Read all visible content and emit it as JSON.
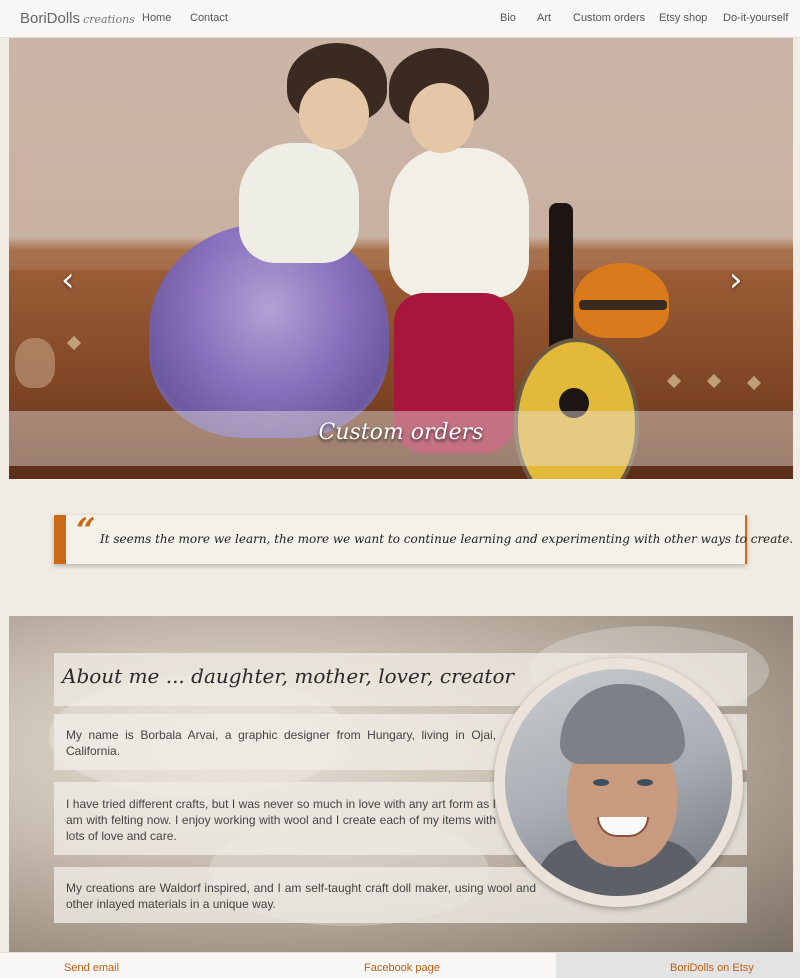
{
  "navbar": {
    "brand": "BoriDolls",
    "brand_sub": "creations",
    "left_links": [
      "Home",
      "Contact"
    ],
    "right_links": [
      "Bio",
      "Art",
      "Custom orders",
      "Etsy shop",
      "Do-it-yourself"
    ]
  },
  "hero": {
    "caption": "Custom orders",
    "prev_icon": "chevron-left-icon",
    "next_icon": "chevron-right-icon"
  },
  "quote": {
    "mark": "“",
    "text": "It seems the more we learn, the more we want to continue learning and experimenting with other ways to create."
  },
  "about": {
    "title": "About me ... daughter, mother, lover, creator",
    "paragraphs": [
      "My name is Borbala Arvai, a graphic designer from Hungary, living in Ojai, California.",
      "I have tried different crafts, but I was never so much in love with any art form as I am with felting now. I enjoy working with wool and I create each of my items with lots of love and care.",
      "My creations are Waldorf inspired, and I am self-taught craft doll maker, using wool and other inlayed materials in a unique way."
    ]
  },
  "footer": {
    "email": "Send email",
    "facebook": "Facebook page",
    "etsy": "BoriDolls on Etsy"
  },
  "colors": {
    "accent": "#cb6a14",
    "background": "#f1ece3",
    "navbar": "#f8f7f5"
  }
}
